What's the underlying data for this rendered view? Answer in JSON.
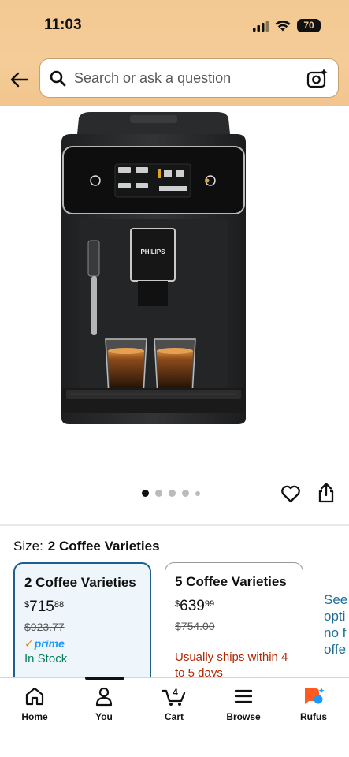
{
  "status": {
    "time": "11:03",
    "battery": "70"
  },
  "search": {
    "placeholder": "Search or ask a question"
  },
  "product": {
    "brand_mark": "PHILIPS",
    "image_count": 5,
    "active_image": 1
  },
  "size": {
    "label": "Size:",
    "selected": "2 Coffee Varieties"
  },
  "options": [
    {
      "title": "2 Coffee Varieties",
      "price_whole": "715",
      "price_cents": "88",
      "price_currency": "$",
      "was_price": "$923.77",
      "prime": "prime",
      "availability": "In Stock"
    },
    {
      "title": "5 Coffee Varieties",
      "price_whole": "639",
      "price_cents": "99",
      "price_currency": "$",
      "was_price": "$754.00",
      "shipping": "Usually ships within 4 to 5 days"
    }
  ],
  "see_more": [
    "See",
    "opti",
    "no f",
    "offe"
  ],
  "tabs": [
    {
      "label": "Home",
      "icon": "home-icon"
    },
    {
      "label": "You",
      "icon": "person-icon"
    },
    {
      "label": "Cart",
      "icon": "cart-icon",
      "badge": "4"
    },
    {
      "label": "Browse",
      "icon": "menu-icon"
    },
    {
      "label": "Rufus",
      "icon": "rufus-icon"
    }
  ],
  "colors": {
    "header": "#f4cc98",
    "selected_border": "#1e5f8c",
    "stock_green": "#067d62",
    "ship_red": "#b12704",
    "link": "#1e6e98",
    "rufus_orange": "#ff5a1f",
    "rufus_blue": "#1a98ff"
  }
}
